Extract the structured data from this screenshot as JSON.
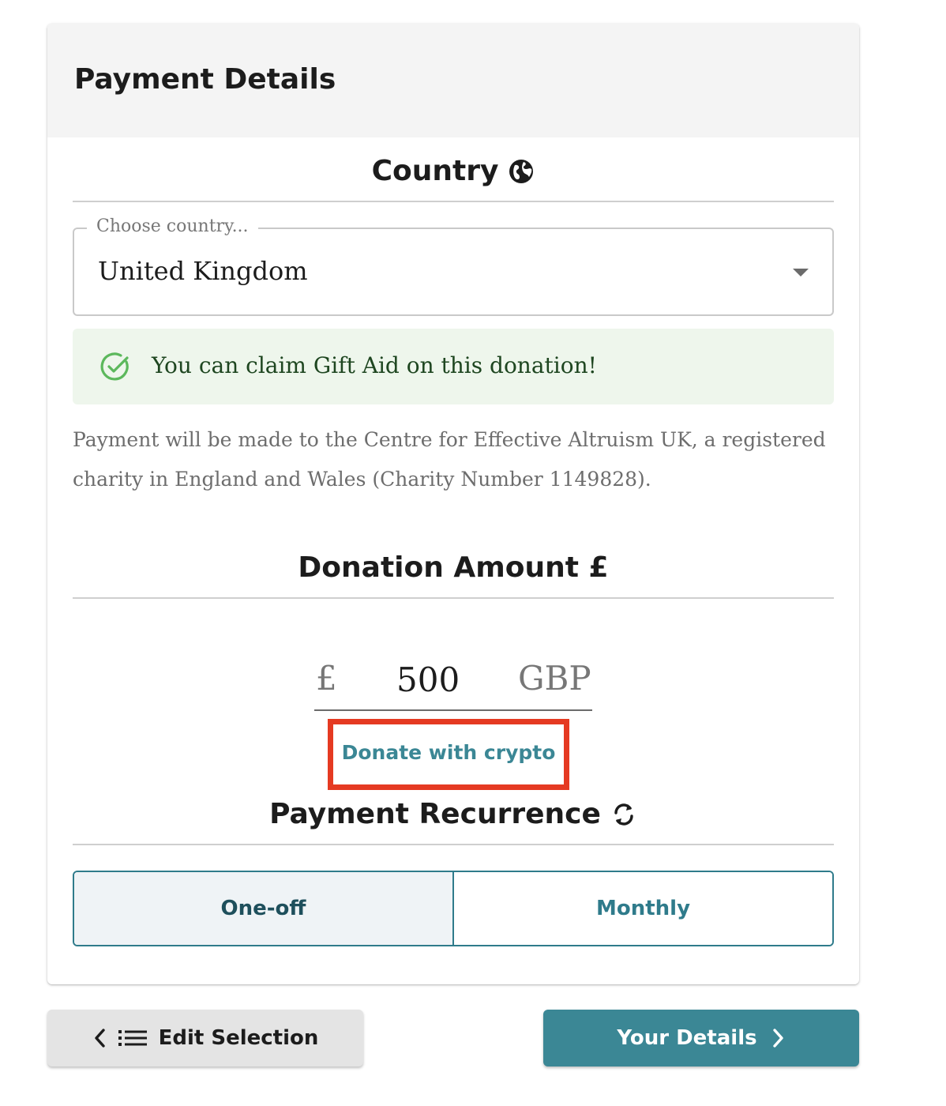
{
  "card": {
    "title": "Payment Details"
  },
  "country": {
    "section_title": "Country",
    "section_icon": "globe-icon",
    "legend": "Choose country...",
    "selected": "United Kingdom",
    "dropdown_icon": "caret-down-icon"
  },
  "gift_aid": {
    "message": "You can claim Gift Aid on this donation!",
    "icon": "check-circle-icon",
    "icon_color": "#5cb85c",
    "background": "#eef6ec"
  },
  "charity_note": "Payment will be made to the Centre for Effective Altruism UK, a registered charity in England and Wales (Charity Number 1149828).",
  "donation": {
    "section_title": "Donation Amount £",
    "currency_symbol": "£",
    "amount": "500",
    "currency_code": "GBP",
    "crypto_link": "Donate with crypto",
    "highlight_color": "#e53a22"
  },
  "recurrence": {
    "section_title": "Payment Recurrence",
    "section_icon": "sync-icon",
    "options": [
      {
        "label": "One-off",
        "selected": true
      },
      {
        "label": "Monthly",
        "selected": false
      }
    ]
  },
  "footer": {
    "back_label": "Edit Selection",
    "back_icons": [
      "chevron-left-icon",
      "list-icon"
    ],
    "next_label": "Your Details",
    "next_icon": "chevron-right-icon"
  },
  "colors": {
    "accent": "#3b8795",
    "header_bg": "#f4f4f4",
    "back_button_bg": "#e4e4e4"
  }
}
